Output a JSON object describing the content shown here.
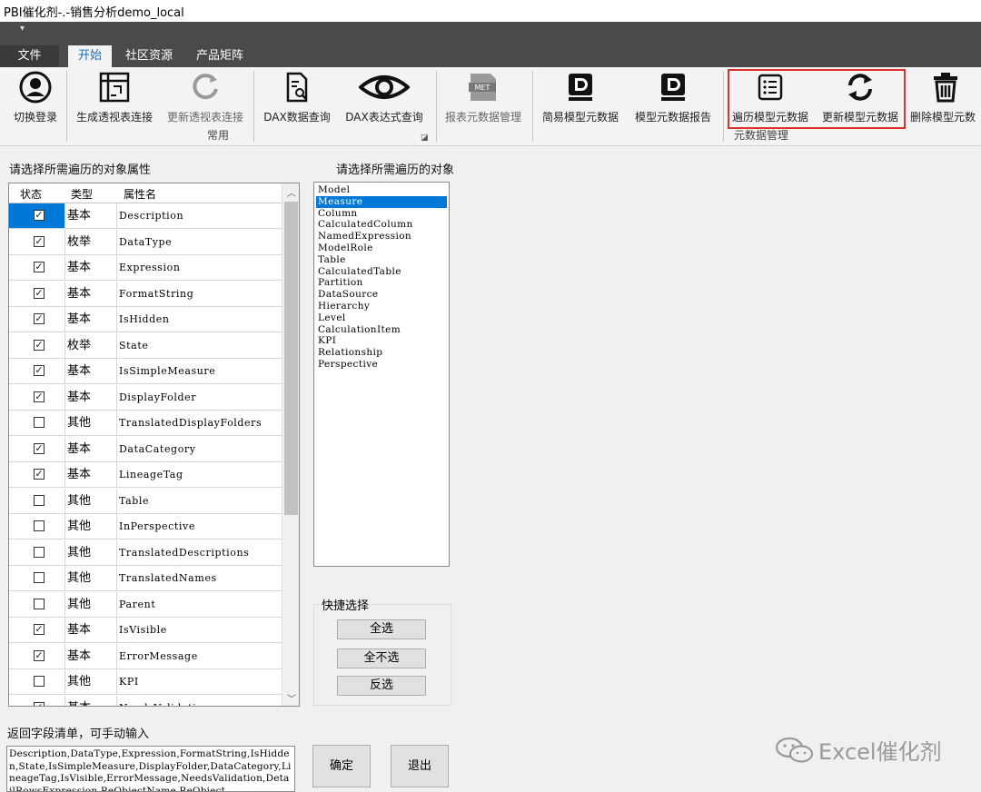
{
  "window": {
    "title": "PBI催化剂-.-销售分析demo_local"
  },
  "ribbon_tabs": [
    {
      "label": "文件"
    },
    {
      "label": "开始"
    },
    {
      "label": "社区资源"
    },
    {
      "label": "产品矩阵"
    }
  ],
  "ribbon": {
    "buttons": [
      {
        "label": "切换登录",
        "icon": "user-circle-icon"
      },
      {
        "label": "生成透视表连接",
        "icon": "pivot-table-icon"
      },
      {
        "label": "更新透视表连接",
        "icon": "refresh-circle-icon"
      },
      {
        "label": "DAX数据查询",
        "icon": "document-search-icon"
      },
      {
        "label": "DAX表达式查询",
        "icon": "eye-icon"
      },
      {
        "label": "报表元数据管理",
        "icon": "met-file-icon"
      },
      {
        "label": "简易模型元数据",
        "icon": "dax-studio-icon"
      },
      {
        "label": "模型元数据报告",
        "icon": "dax-studio-icon"
      },
      {
        "label": "遍历模型元数据",
        "icon": "list-icon"
      },
      {
        "label": "更新模型元数据",
        "icon": "sync-icon"
      },
      {
        "label": "删除模型元数",
        "icon": "trash-icon"
      }
    ],
    "groups": {
      "common": "常用",
      "metadata": "元数据管理"
    }
  },
  "properties_panel": {
    "label": "请选择所需遍历的对象属性",
    "headers": {
      "status": "状态",
      "type": "类型",
      "name": "属性名"
    },
    "rows": [
      {
        "checked": true,
        "type": "基本",
        "name": "Description",
        "selected": true
      },
      {
        "checked": true,
        "type": "枚举",
        "name": "DataType"
      },
      {
        "checked": true,
        "type": "基本",
        "name": "Expression"
      },
      {
        "checked": true,
        "type": "基本",
        "name": "FormatString"
      },
      {
        "checked": true,
        "type": "基本",
        "name": "IsHidden"
      },
      {
        "checked": true,
        "type": "枚举",
        "name": "State"
      },
      {
        "checked": true,
        "type": "基本",
        "name": "IsSimpleMeasure"
      },
      {
        "checked": true,
        "type": "基本",
        "name": "DisplayFolder"
      },
      {
        "checked": false,
        "type": "其他",
        "name": "TranslatedDisplayFolders"
      },
      {
        "checked": true,
        "type": "基本",
        "name": "DataCategory"
      },
      {
        "checked": true,
        "type": "基本",
        "name": "LineageTag"
      },
      {
        "checked": false,
        "type": "其他",
        "name": "Table"
      },
      {
        "checked": false,
        "type": "其他",
        "name": "InPerspective"
      },
      {
        "checked": false,
        "type": "其他",
        "name": "TranslatedDescriptions"
      },
      {
        "checked": false,
        "type": "其他",
        "name": "TranslatedNames"
      },
      {
        "checked": false,
        "type": "其他",
        "name": "Parent"
      },
      {
        "checked": true,
        "type": "基本",
        "name": "IsVisible"
      },
      {
        "checked": true,
        "type": "基本",
        "name": "ErrorMessage"
      },
      {
        "checked": false,
        "type": "其他",
        "name": "KPI"
      },
      {
        "checked": true,
        "type": "基本",
        "name": "NeedsValidation"
      }
    ]
  },
  "objects_panel": {
    "label": "请选择所需遍历的对象",
    "items": [
      "Model",
      "Measure",
      "Column",
      "CalculatedColumn",
      "NamedExpression",
      "ModelRole",
      "Table",
      "CalculatedTable",
      "Partition",
      "DataSource",
      "Hierarchy",
      "Level",
      "CalculationItem",
      "KPI",
      "Relationship",
      "Perspective"
    ],
    "selected_index": 1
  },
  "quick_select": {
    "label": "快捷选择",
    "select_all": "全选",
    "select_none": "全不选",
    "invert": "反选"
  },
  "output": {
    "label": "返回字段清单，可手动输入",
    "text": "Description,DataType,Expression,FormatString,IsHidden,State,IsSimpleMeasure,DisplayFolder,DataCategory,LineageTag,IsVisible,ErrorMessage,NeedsValidation,DetailRowsExpression,ReObjectName,ReObject"
  },
  "buttons": {
    "ok": "确定",
    "exit": "退出"
  },
  "watermark": "Excel催化剂",
  "colors": {
    "selection": "#0078d7",
    "highlight_box": "#e0302e",
    "ribbon_dark": "#4a4a4a"
  }
}
